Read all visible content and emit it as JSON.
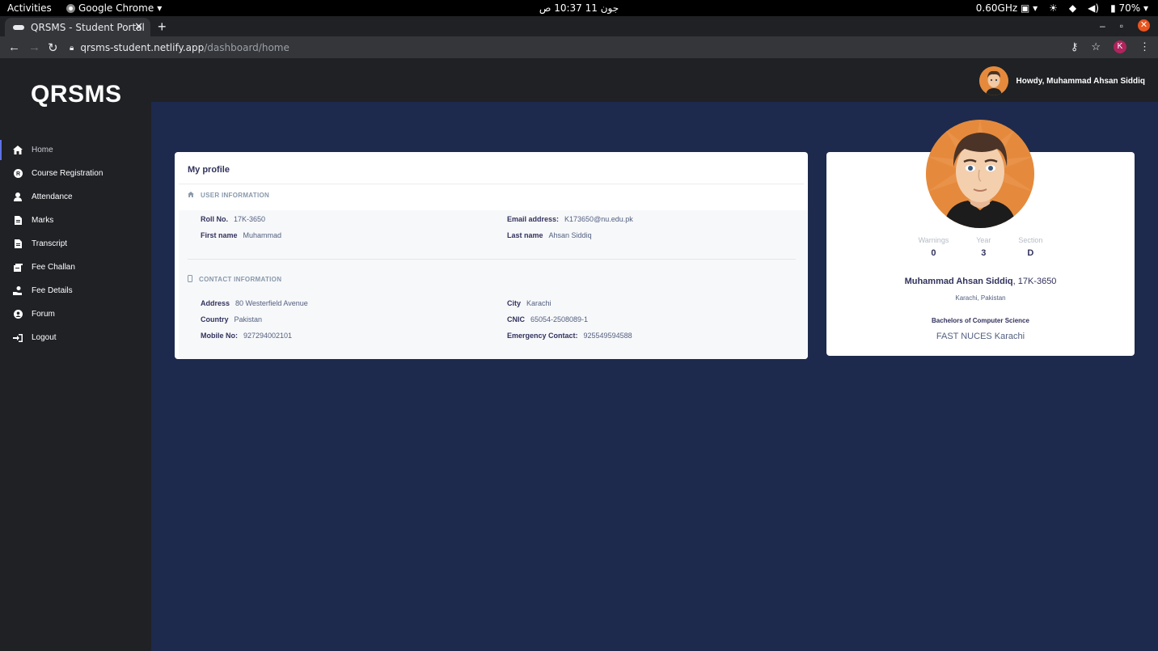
{
  "system_bar": {
    "activities": "Activities",
    "app_name": "Google Chrome",
    "clock": "جون 11  10:37 ص",
    "cpu": "0.60GHz",
    "battery": "70%"
  },
  "browser": {
    "tab_title": "QRSMS - Student Portal",
    "url_host": "qrsms-student.netlify.app",
    "url_path": "/dashboard/home",
    "profile_initial": "K"
  },
  "sidebar": {
    "brand": "QRSMS",
    "items": [
      {
        "label": "Home",
        "icon": "home-icon",
        "active": true
      },
      {
        "label": "Course Registration",
        "icon": "registered-icon"
      },
      {
        "label": "Attendance",
        "icon": "user-icon"
      },
      {
        "label": "Marks",
        "icon": "file-icon"
      },
      {
        "label": "Transcript",
        "icon": "file-icon"
      },
      {
        "label": "Fee Challan",
        "icon": "receipt-icon"
      },
      {
        "label": "Fee Details",
        "icon": "hand-coins-icon"
      },
      {
        "label": "Forum",
        "icon": "user-circle-icon"
      },
      {
        "label": "Logout",
        "icon": "sign-out-icon"
      }
    ]
  },
  "header": {
    "greeting": "Howdy, Muhammad Ahsan Siddiq"
  },
  "profile": {
    "title": "My profile",
    "user_section": "USER INFORMATION",
    "contact_section": "CONTACT INFORMATION",
    "roll_label": "Roll No.",
    "roll_value": "17K-3650",
    "email_label": "Email address:",
    "email_value": "K173650@nu.edu.pk",
    "first_label": "First name",
    "first_value": "Muhammad",
    "last_label": "Last name",
    "last_value": "Ahsan Siddiq",
    "address_label": "Address",
    "address_value": "80 Westerfield Avenue",
    "city_label": "City",
    "city_value": "Karachi",
    "country_label": "Country",
    "country_value": "Pakistan",
    "cnic_label": "CNIC",
    "cnic_value": "65054-2508089-1",
    "mobile_label": "Mobile No:",
    "mobile_value": "927294002101",
    "emergency_label": "Emergency Contact:",
    "emergency_value": "925549594588"
  },
  "summary": {
    "warnings_label": "Warnings",
    "warnings_value": "0",
    "year_label": "Year",
    "year_value": "3",
    "section_label": "Section",
    "section_value": "D",
    "name": "Muhammad Ahsan Siddiq",
    "roll": ", 17K-3650",
    "location": "Karachi, Pakistan",
    "degree": "Bachelors of Computer Science",
    "institute": "FAST NUCES Karachi"
  }
}
